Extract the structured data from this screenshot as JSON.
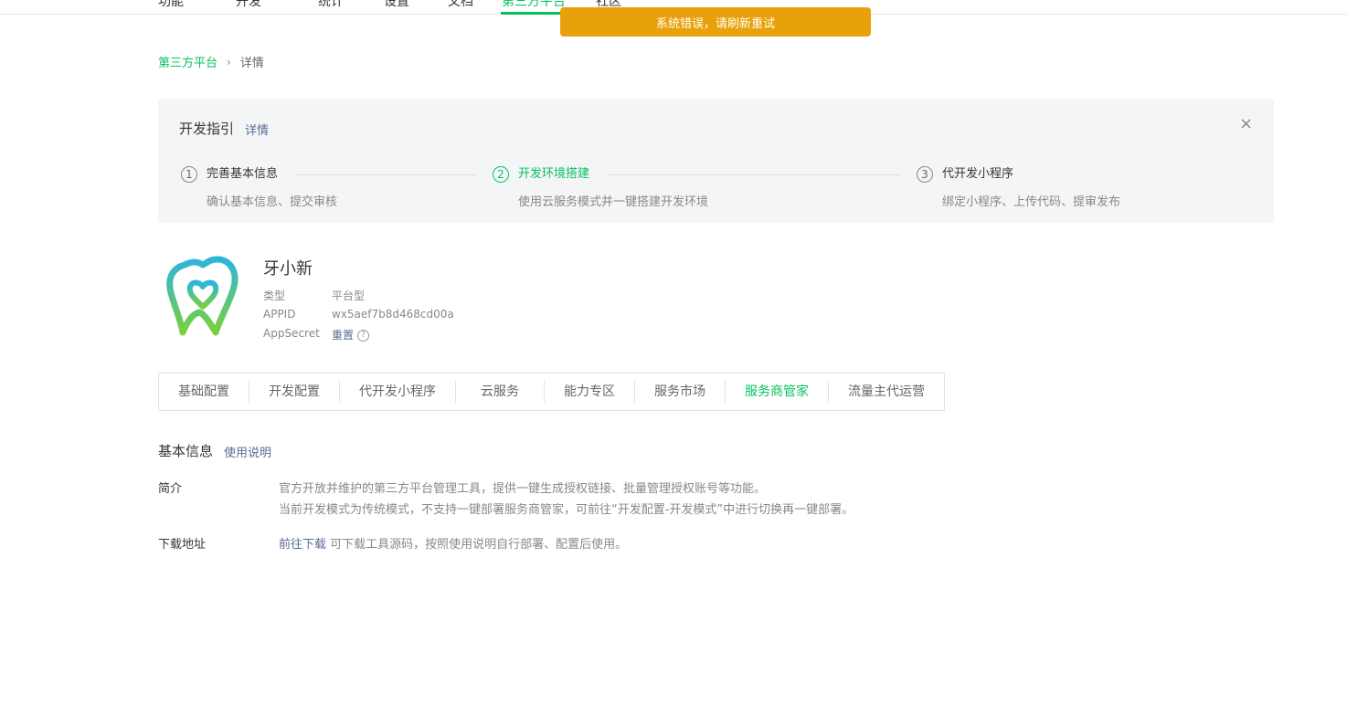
{
  "topnav": {
    "items": [
      {
        "label": "功能"
      },
      {
        "label": "开发"
      },
      {
        "label": "统计"
      },
      {
        "label": "设置"
      },
      {
        "label": "文档"
      },
      {
        "label": "第三方平台"
      },
      {
        "label": "社区"
      }
    ],
    "active_index": 5
  },
  "toast": {
    "message": "系统错误，请刷新重试"
  },
  "breadcrumb": {
    "root": "第三方平台",
    "separator": "›",
    "current": "详情"
  },
  "guide": {
    "title": "开发指引",
    "detail_link": "详情",
    "close_icon": "×",
    "steps": [
      {
        "num": "1",
        "title": "完善基本信息",
        "desc": "确认基本信息、提交审核"
      },
      {
        "num": "2",
        "title": "开发环境搭建",
        "desc": "使用云服务模式并一键搭建开发环境"
      },
      {
        "num": "3",
        "title": "代开发小程序",
        "desc": "绑定小程序、上传代码、提审发布"
      }
    ],
    "active_step": 2
  },
  "app": {
    "name": "牙小新",
    "type_label": "类型",
    "type_value": "平台型",
    "appid_label": "APPID",
    "appid_value": "wx5aef7b8d468cd00a",
    "secret_label": "AppSecret",
    "secret_action": "重置",
    "help_icon": "?"
  },
  "tabs": {
    "items": [
      "基础配置",
      "开发配置",
      "代开发小程序",
      "云服务",
      "能力专区",
      "服务市场",
      "服务商管家",
      "流量主代运营"
    ],
    "active_index": 6
  },
  "basic_info": {
    "title": "基本信息",
    "help_link": "使用说明",
    "intro_label": "简介",
    "intro_line1": "官方开放并维护的第三方平台管理工具，提供一键生成授权链接、批量管理授权账号等功能。",
    "intro_line2": "当前开发模式为传统模式，不支持一键部署服务商管家，可前往“开发配置-开发模式”中进行切换再一键部署。",
    "download_label": "下载地址",
    "download_link": "前往下载",
    "download_text": "可下载工具源码，按照使用说明自行部署、配置后使用。"
  },
  "colors": {
    "accent": "#07c160",
    "link": "#576b95",
    "toast_bg": "#e9a10b",
    "guide_bg": "#f4f5f7"
  }
}
